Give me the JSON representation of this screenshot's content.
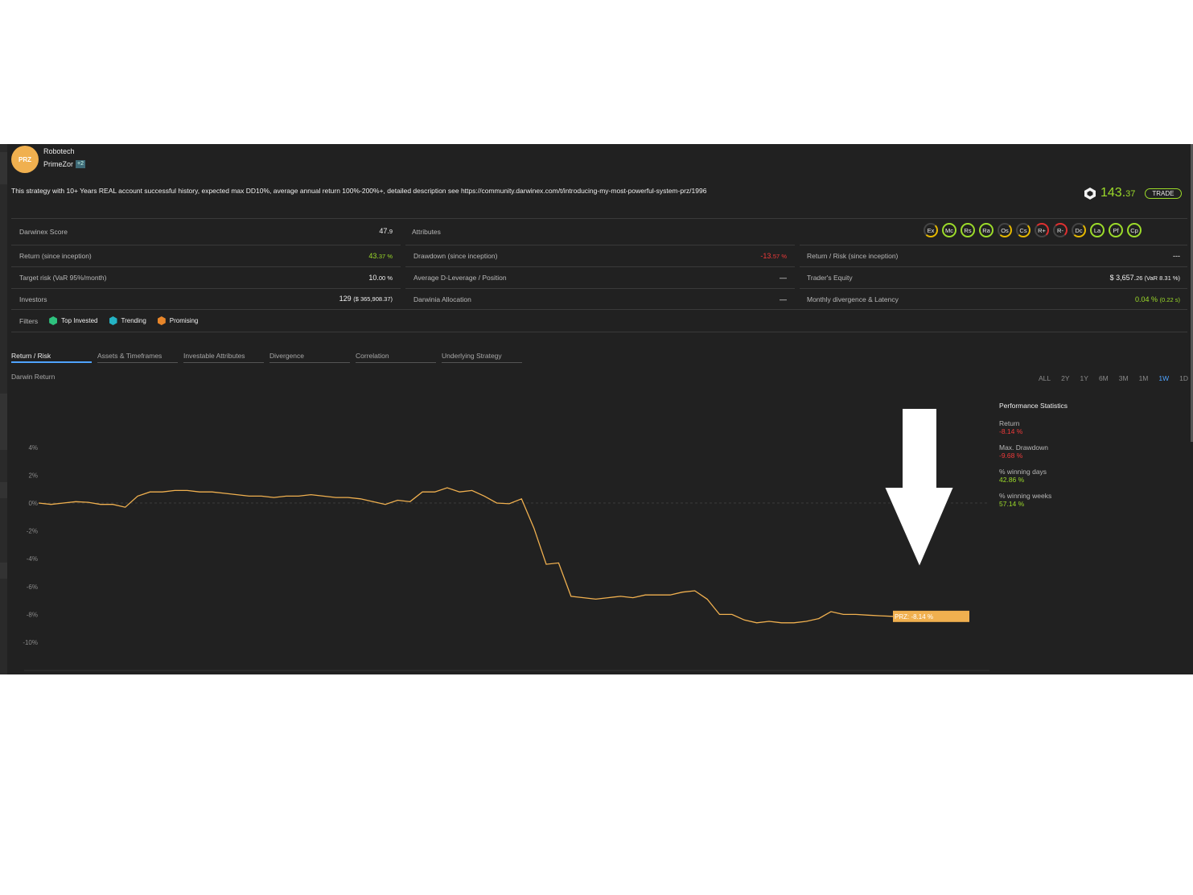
{
  "header": {
    "avatar_initials": "PRZ",
    "organization": "Robotech",
    "name": "PrimeZor",
    "plus_badge": "+2",
    "description": "This strategy with 10+ Years REAL account successful history, expected max DD10%, average annual return 100%-200%+, detailed description see https://community.darwinex.com/t/introducing-my-most-powerful-system-prz/1996",
    "price_main": "143.",
    "price_decimals": "37",
    "trade_label": "TRADE"
  },
  "stats": {
    "darwinex_score_label": "Darwinex Score",
    "darwinex_score_main": "47.",
    "darwinex_score_dec": "9",
    "attributes_label": "Attributes",
    "return_label": "Return (since inception)",
    "return_main": "43.",
    "return_dec": "37 %",
    "drawdown_label": "Drawdown (since inception)",
    "drawdown_main": "-13.",
    "drawdown_dec": "57 %",
    "return_risk_label": "Return / Risk (since inception)",
    "return_risk_value": "---",
    "target_risk_label": "Target risk (VaR 95%/month)",
    "target_risk_main": "10.",
    "target_risk_dec": "00 %",
    "dleverage_label": "Average D-Leverage / Position",
    "dleverage_value": "—",
    "equity_label": "Trader's Equity",
    "equity_main": "$ 3,657.",
    "equity_dec": "26 (VaR 8.31 %)",
    "investors_label": "Investors",
    "investors_main": "129",
    "investors_dec": "($ 365,908.37)",
    "allocation_label": "Darwinia Allocation",
    "allocation_value": "—",
    "divergence_label": "Monthly divergence & Latency",
    "divergence_main": "0.04 %",
    "divergence_dec": "(0.22 s)"
  },
  "attributes": [
    "Ex",
    "Mc",
    "Rs",
    "Ra",
    "Os",
    "Cs",
    "R+",
    "R-",
    "Dc",
    "La",
    "Pf",
    "Cp"
  ],
  "filters": {
    "label": "Filters",
    "chips": [
      {
        "label": "Top Invested",
        "color": "#2ec27e"
      },
      {
        "label": "Trending",
        "color": "#24b3c4"
      },
      {
        "label": "Promising",
        "color": "#e8862a"
      }
    ]
  },
  "tabs": [
    "Return / Risk",
    "Assets & Timeframes",
    "Investable Attributes",
    "Divergence",
    "Correlation",
    "Underlying Strategy"
  ],
  "chart_title": "Darwin Return",
  "ranges": [
    "ALL",
    "2Y",
    "1Y",
    "6M",
    "3M",
    "1M",
    "1W",
    "1D"
  ],
  "active_range": "1W",
  "performance": {
    "title": "Performance Statistics",
    "items": [
      {
        "label": "Return",
        "value": "-8.14 %",
        "tone": "red"
      },
      {
        "label": "Max. Drawdown",
        "value": "-9.68 %",
        "tone": "red"
      },
      {
        "label": "% winning days",
        "value": "42.86 %",
        "tone": "green"
      },
      {
        "label": "% winning weeks",
        "value": "57.14 %",
        "tone": "green"
      }
    ]
  },
  "colors": {
    "accent_green": "#9cdb2a",
    "negative": "#f03a3a",
    "line": "#f0b04f",
    "active_tab": "#4fa3ff"
  },
  "chart_data": {
    "type": "line",
    "title": "Darwin Return",
    "ylim": [
      -10,
      4
    ],
    "y_ticks": [
      "4%",
      "2%",
      "0%",
      "-2%",
      "-4%",
      "-6%",
      "-8%",
      "-10%"
    ],
    "series": [
      {
        "name": "PRZ",
        "end_label": "PRZ: -8.14 %",
        "values": [
          0.0,
          -0.1,
          0.0,
          0.1,
          0.05,
          -0.1,
          -0.1,
          -0.3,
          0.5,
          0.8,
          0.8,
          0.9,
          0.9,
          0.8,
          0.8,
          0.7,
          0.6,
          0.5,
          0.5,
          0.4,
          0.5,
          0.5,
          0.6,
          0.5,
          0.4,
          0.4,
          0.3,
          0.1,
          -0.1,
          0.2,
          0.1,
          0.8,
          0.8,
          1.1,
          0.8,
          0.9,
          0.5,
          0.0,
          -0.05,
          0.3,
          -1.8,
          -4.4,
          -4.3,
          -6.7,
          -6.8,
          -6.9,
          -6.8,
          -6.7,
          -6.8,
          -6.6,
          -6.6,
          -6.6,
          -6.4,
          -6.3,
          -6.9,
          -8.0,
          -8.0,
          -8.4,
          -8.6,
          -8.5,
          -8.6,
          -8.6,
          -8.5,
          -8.3,
          -7.8,
          -8.0,
          -8.0,
          -8.05,
          -8.1,
          -8.14
        ]
      }
    ]
  }
}
